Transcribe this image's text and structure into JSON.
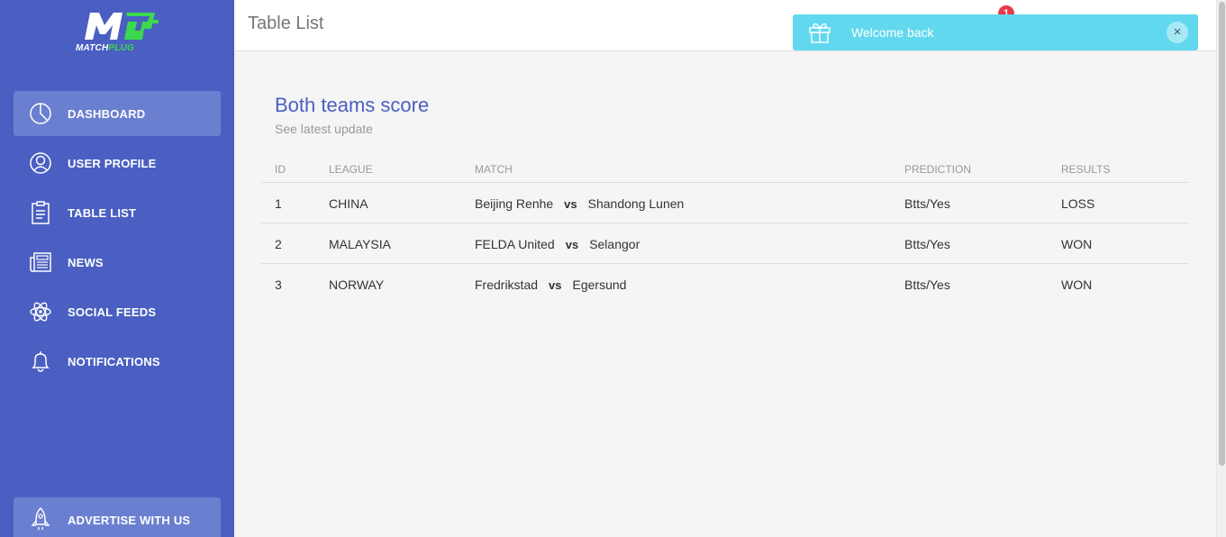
{
  "brand": {
    "logo_text_main": "MATCH",
    "logo_text_accent": "PLUG",
    "logo_letter": "M"
  },
  "sidebar": {
    "items": [
      {
        "label": "DASHBOARD",
        "icon": "pie-chart-icon",
        "active": true
      },
      {
        "label": "USER PROFILE",
        "icon": "user-icon"
      },
      {
        "label": "TABLE LIST",
        "icon": "clipboard-icon"
      },
      {
        "label": "NEWS",
        "icon": "newspaper-icon"
      },
      {
        "label": "SOCIAL FEEDS",
        "icon": "atom-icon"
      },
      {
        "label": "NOTIFICATIONS",
        "icon": "bell-icon"
      }
    ],
    "advertise": {
      "label": "ADVERTISE WITH US",
      "icon": "rocket-icon"
    }
  },
  "header": {
    "title": "Table List",
    "notification_count": "1"
  },
  "toast": {
    "message": "Welcome back",
    "close": "×",
    "icon": "gift-icon"
  },
  "card": {
    "title": "Both teams score",
    "subtitle": "See latest update",
    "columns": {
      "id": "ID",
      "league": "LEAGUE",
      "match": "MATCH",
      "prediction": "PREDICTION",
      "results": "RESULTS"
    },
    "rows": [
      {
        "id": "1",
        "league": "CHINA",
        "home": "Beijing Renhe",
        "vs": "vs",
        "away": "Shandong Lunen",
        "prediction": "Btts/Yes",
        "result": "LOSS"
      },
      {
        "id": "2",
        "league": "MALAYSIA",
        "home": "FELDA United",
        "vs": "vs",
        "away": "Selangor",
        "prediction": "Btts/Yes",
        "result": "WON"
      },
      {
        "id": "3",
        "league": "NORWAY",
        "home": "Fredrikstad",
        "vs": "vs",
        "away": "Egersund",
        "prediction": "Btts/Yes",
        "result": "WON"
      }
    ]
  },
  "colors": {
    "sidebar": "#4a5fc1",
    "sidebar_active": "#6b7fd1",
    "accent_green": "#3bd94e",
    "toast": "#62d8ee",
    "badge": "#e83a4b",
    "title_blue": "#4a5fc1"
  }
}
